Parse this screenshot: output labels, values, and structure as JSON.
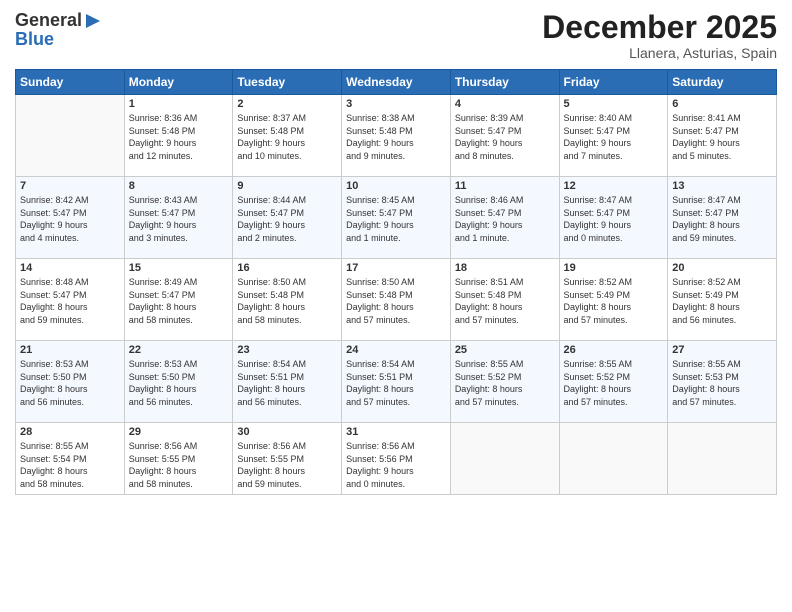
{
  "header": {
    "logo_line1": "General",
    "logo_line2": "Blue",
    "month": "December 2025",
    "location": "Llanera, Asturias, Spain"
  },
  "days_of_week": [
    "Sunday",
    "Monday",
    "Tuesday",
    "Wednesday",
    "Thursday",
    "Friday",
    "Saturday"
  ],
  "weeks": [
    [
      {
        "day": "",
        "info": ""
      },
      {
        "day": "1",
        "info": "Sunrise: 8:36 AM\nSunset: 5:48 PM\nDaylight: 9 hours\nand 12 minutes."
      },
      {
        "day": "2",
        "info": "Sunrise: 8:37 AM\nSunset: 5:48 PM\nDaylight: 9 hours\nand 10 minutes."
      },
      {
        "day": "3",
        "info": "Sunrise: 8:38 AM\nSunset: 5:48 PM\nDaylight: 9 hours\nand 9 minutes."
      },
      {
        "day": "4",
        "info": "Sunrise: 8:39 AM\nSunset: 5:47 PM\nDaylight: 9 hours\nand 8 minutes."
      },
      {
        "day": "5",
        "info": "Sunrise: 8:40 AM\nSunset: 5:47 PM\nDaylight: 9 hours\nand 7 minutes."
      },
      {
        "day": "6",
        "info": "Sunrise: 8:41 AM\nSunset: 5:47 PM\nDaylight: 9 hours\nand 5 minutes."
      }
    ],
    [
      {
        "day": "7",
        "info": "Sunrise: 8:42 AM\nSunset: 5:47 PM\nDaylight: 9 hours\nand 4 minutes."
      },
      {
        "day": "8",
        "info": "Sunrise: 8:43 AM\nSunset: 5:47 PM\nDaylight: 9 hours\nand 3 minutes."
      },
      {
        "day": "9",
        "info": "Sunrise: 8:44 AM\nSunset: 5:47 PM\nDaylight: 9 hours\nand 2 minutes."
      },
      {
        "day": "10",
        "info": "Sunrise: 8:45 AM\nSunset: 5:47 PM\nDaylight: 9 hours\nand 1 minute."
      },
      {
        "day": "11",
        "info": "Sunrise: 8:46 AM\nSunset: 5:47 PM\nDaylight: 9 hours\nand 1 minute."
      },
      {
        "day": "12",
        "info": "Sunrise: 8:47 AM\nSunset: 5:47 PM\nDaylight: 9 hours\nand 0 minutes."
      },
      {
        "day": "13",
        "info": "Sunrise: 8:47 AM\nSunset: 5:47 PM\nDaylight: 8 hours\nand 59 minutes."
      }
    ],
    [
      {
        "day": "14",
        "info": "Sunrise: 8:48 AM\nSunset: 5:47 PM\nDaylight: 8 hours\nand 59 minutes."
      },
      {
        "day": "15",
        "info": "Sunrise: 8:49 AM\nSunset: 5:47 PM\nDaylight: 8 hours\nand 58 minutes."
      },
      {
        "day": "16",
        "info": "Sunrise: 8:50 AM\nSunset: 5:48 PM\nDaylight: 8 hours\nand 58 minutes."
      },
      {
        "day": "17",
        "info": "Sunrise: 8:50 AM\nSunset: 5:48 PM\nDaylight: 8 hours\nand 57 minutes."
      },
      {
        "day": "18",
        "info": "Sunrise: 8:51 AM\nSunset: 5:48 PM\nDaylight: 8 hours\nand 57 minutes."
      },
      {
        "day": "19",
        "info": "Sunrise: 8:52 AM\nSunset: 5:49 PM\nDaylight: 8 hours\nand 57 minutes."
      },
      {
        "day": "20",
        "info": "Sunrise: 8:52 AM\nSunset: 5:49 PM\nDaylight: 8 hours\nand 56 minutes."
      }
    ],
    [
      {
        "day": "21",
        "info": "Sunrise: 8:53 AM\nSunset: 5:50 PM\nDaylight: 8 hours\nand 56 minutes."
      },
      {
        "day": "22",
        "info": "Sunrise: 8:53 AM\nSunset: 5:50 PM\nDaylight: 8 hours\nand 56 minutes."
      },
      {
        "day": "23",
        "info": "Sunrise: 8:54 AM\nSunset: 5:51 PM\nDaylight: 8 hours\nand 56 minutes."
      },
      {
        "day": "24",
        "info": "Sunrise: 8:54 AM\nSunset: 5:51 PM\nDaylight: 8 hours\nand 57 minutes."
      },
      {
        "day": "25",
        "info": "Sunrise: 8:55 AM\nSunset: 5:52 PM\nDaylight: 8 hours\nand 57 minutes."
      },
      {
        "day": "26",
        "info": "Sunrise: 8:55 AM\nSunset: 5:52 PM\nDaylight: 8 hours\nand 57 minutes."
      },
      {
        "day": "27",
        "info": "Sunrise: 8:55 AM\nSunset: 5:53 PM\nDaylight: 8 hours\nand 57 minutes."
      }
    ],
    [
      {
        "day": "28",
        "info": "Sunrise: 8:55 AM\nSunset: 5:54 PM\nDaylight: 8 hours\nand 58 minutes."
      },
      {
        "day": "29",
        "info": "Sunrise: 8:56 AM\nSunset: 5:55 PM\nDaylight: 8 hours\nand 58 minutes."
      },
      {
        "day": "30",
        "info": "Sunrise: 8:56 AM\nSunset: 5:55 PM\nDaylight: 8 hours\nand 59 minutes."
      },
      {
        "day": "31",
        "info": "Sunrise: 8:56 AM\nSunset: 5:56 PM\nDaylight: 9 hours\nand 0 minutes."
      },
      {
        "day": "",
        "info": ""
      },
      {
        "day": "",
        "info": ""
      },
      {
        "day": "",
        "info": ""
      }
    ]
  ]
}
